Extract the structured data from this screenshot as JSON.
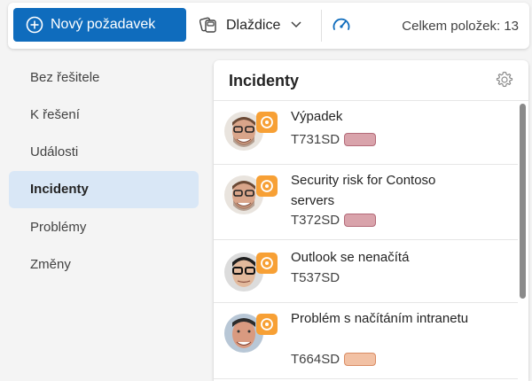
{
  "toolbar": {
    "new_request_label": "Nový požadavek",
    "view_label": "Dlaždice",
    "count_label": "Celkem položek: 13",
    "accent": "#0f6cbd"
  },
  "sidebar": {
    "items": [
      {
        "label": "Bez řešitele"
      },
      {
        "label": "K řešení"
      },
      {
        "label": "Události"
      },
      {
        "label": "Incidenty",
        "active": true
      },
      {
        "label": "Problémy"
      },
      {
        "label": "Změny"
      }
    ]
  },
  "panel": {
    "title": "Incidenty",
    "items": [
      {
        "title": "Výpadek",
        "id": "T731SD",
        "tag_color": "#d9a3ab"
      },
      {
        "title": "Security risk for Contoso servers",
        "id": "T372SD",
        "tag_color": "#d9a3ab"
      },
      {
        "title": "Outlook se nenačítá",
        "id": "T537SD"
      },
      {
        "title": "Problém s načítáním intranetu",
        "id": "T664SD",
        "tag_color": "#f2c1a4"
      }
    ]
  },
  "icons": {
    "new": "plus-circle-icon",
    "view": "tiles-icon",
    "dropdown": "chevron-down-icon",
    "dashboard": "gauge-icon",
    "settings": "gear-icon",
    "badge": "ticket-badge-icon"
  }
}
